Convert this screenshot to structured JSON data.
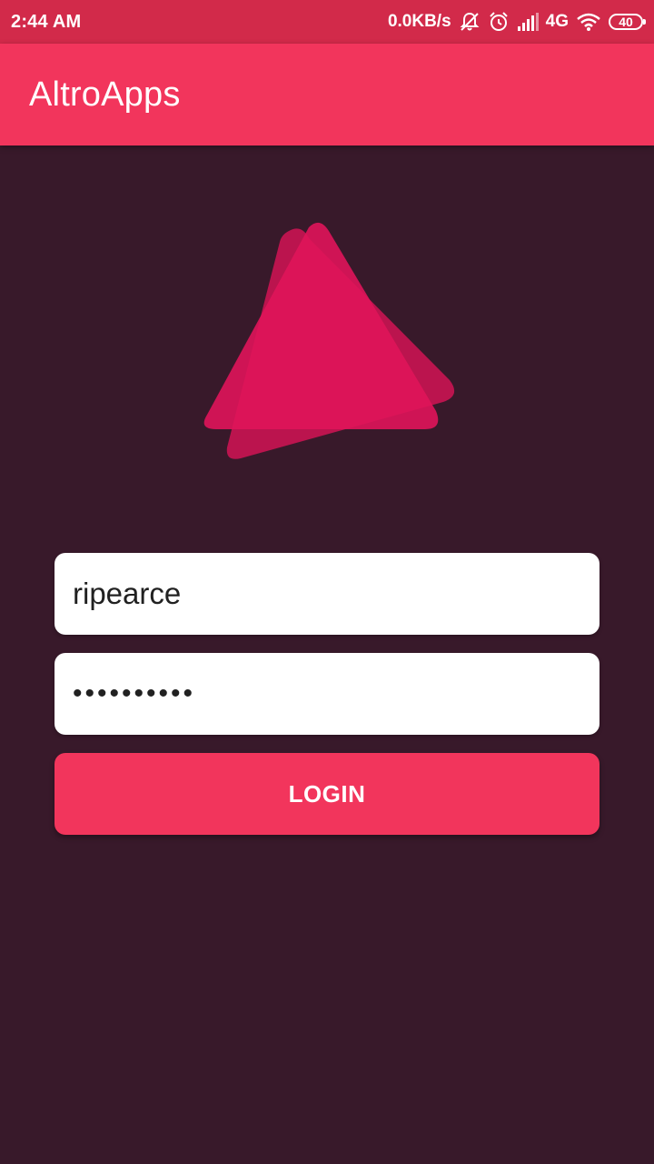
{
  "status_bar": {
    "time": "2:44 AM",
    "network_speed": "0.0KB/s",
    "network_type": "4G",
    "battery": "40",
    "icons": [
      "muted-bell-icon",
      "alarm-icon",
      "signal-icon",
      "wifi-icon",
      "battery-icon"
    ]
  },
  "app_bar": {
    "title": "AltroApps"
  },
  "login_form": {
    "username_value": "ripearce",
    "password_value": "••••••••••",
    "login_label": "LOGIN"
  },
  "colors": {
    "status_bar": "#d22a4a",
    "app_bar": "#f2355c",
    "background": "#38192a",
    "logo_primary": "#e0145a",
    "logo_secondary": "#c21450",
    "button": "#f2355c"
  }
}
